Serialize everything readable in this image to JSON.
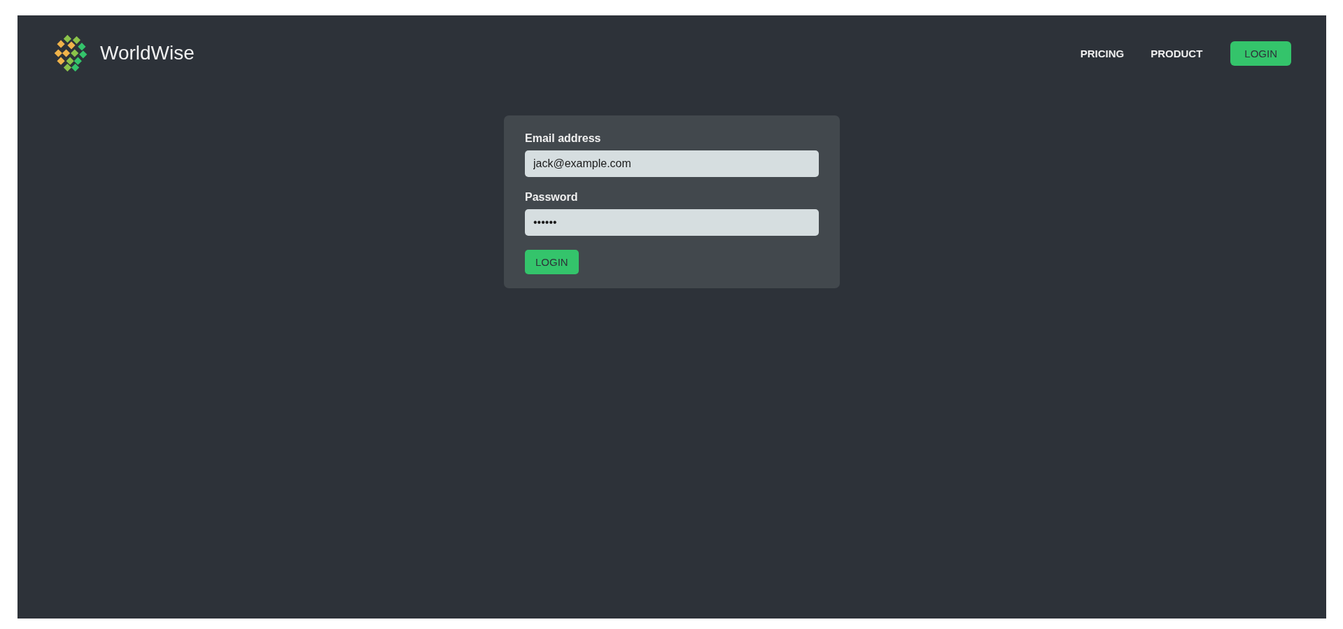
{
  "brand": {
    "name": "WorldWise"
  },
  "nav": [
    {
      "label": "PRICING",
      "kind": "link"
    },
    {
      "label": "PRODUCT",
      "kind": "link"
    },
    {
      "label": "LOGIN",
      "kind": "button"
    }
  ],
  "form": {
    "fields": [
      {
        "label": "Email address",
        "value": "jack@example.com"
      },
      {
        "label": "Password",
        "value": "••••••"
      }
    ],
    "submit": "LOGIN"
  }
}
